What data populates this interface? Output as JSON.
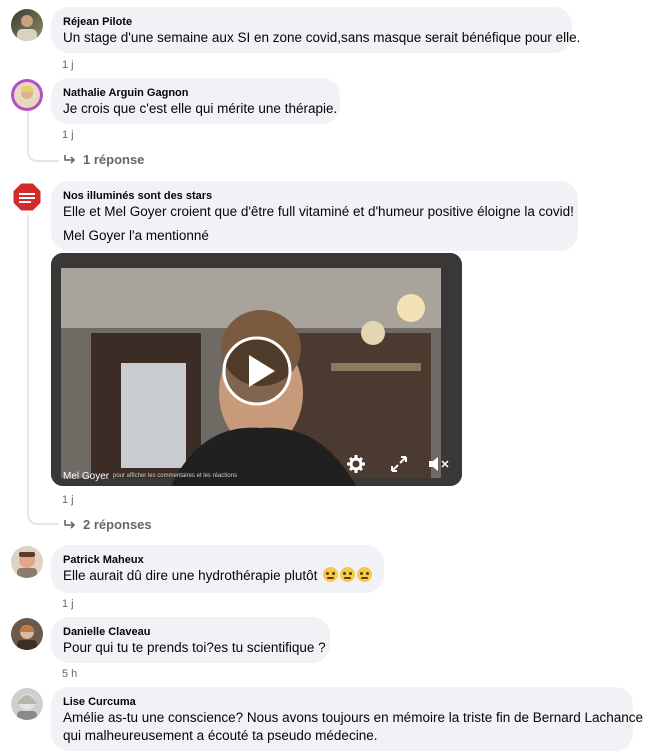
{
  "comments": [
    {
      "author": "Réjean Pilote",
      "text": "Un stage d'une semaine aux SI en zone covid,sans masque serait bénéfique pour elle.",
      "time": "1 j"
    },
    {
      "author": "Nathalie Arguin Gagnon",
      "text": "Je crois que c'est elle qui mérite une thérapie.",
      "time": "1 j",
      "replies": "1 réponse"
    },
    {
      "author": "Nos illuminés sont des stars",
      "text": "Elle et Mel Goyer croient que d'être full vitaminé et d'humeur positive éloigne la covid!",
      "mention": "Mel Goyer l'a mentionné",
      "time": "1 j",
      "replies": "2 réponses",
      "video": {
        "caption": "Mel Goyer",
        "overlay_text": "pour afficher les commentaires et les réactions"
      }
    },
    {
      "author": "Patrick Maheux",
      "text": "Elle aurait dû dire une hydrothérapie plutôt",
      "emojis": [
        "rolling-eyes-emoji",
        "thinking-emoji",
        "rolling-eyes-emoji"
      ],
      "time": "1 j"
    },
    {
      "author": "Danielle Claveau",
      "text": "Pour qui tu te prends toi?es tu scientifique ?",
      "time": "5 h"
    },
    {
      "author": "Lise Curcuma",
      "text_lines": [
        "Amélie as-tu une conscience? Nous avons toujours en mémoire la triste fin de Bernard Lachance",
        "qui malheureusement a écouté ta pseudo médecine."
      ]
    }
  ],
  "colors": {
    "bubble": "#f0f2f5",
    "secondary_text": "#65676b",
    "thread_line": "#e4e6eb"
  }
}
